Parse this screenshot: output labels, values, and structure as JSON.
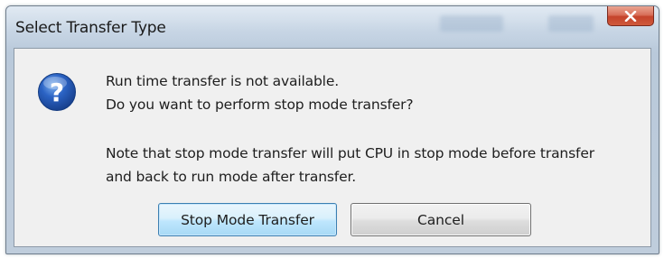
{
  "dialog": {
    "title": "Select Transfer Type",
    "icon": "question-icon",
    "message_line_1": "Run time transfer is not available.",
    "message_line_2": "Do you want to perform stop mode transfer?",
    "note_line_1": "Note that stop mode transfer will put CPU in stop mode before transfer",
    "note_line_2": "and back to run mode after transfer.",
    "buttons": {
      "primary_label": "Stop Mode Transfer",
      "cancel_label": "Cancel"
    }
  },
  "colors": {
    "title_bar": "#c3d2e2",
    "close_button": "#c5432b",
    "client_background": "#f0f0f0",
    "icon_blue": "#2b63c4",
    "default_button_border": "#3c7fb1"
  }
}
